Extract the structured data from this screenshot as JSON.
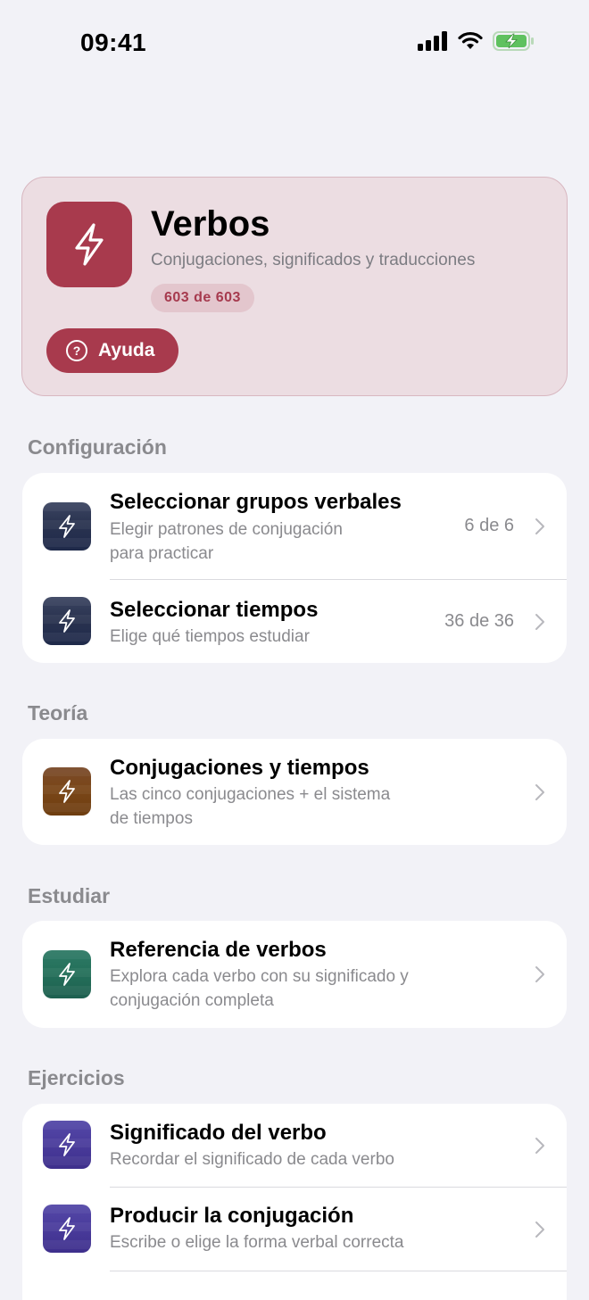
{
  "status_bar": {
    "time": "09:41"
  },
  "hero": {
    "title": "Verbos",
    "subtitle": "Conjugaciones, significados y traducciones",
    "badge": "603 de 603",
    "help_label": "Ayuda",
    "help_glyph": "?",
    "accent_color": "#A83A4D",
    "icon": "lightning-bolt-icon"
  },
  "sections": {
    "configuracion": {
      "header": "Configuración",
      "rows": [
        {
          "title": "Seleccionar grupos verbales",
          "subtitle_line1": "Elegir patrones de conjugación",
          "subtitle_line2": "para practicar",
          "value": "6 de 6",
          "icon_color": "#2A3350"
        },
        {
          "title": "Seleccionar tiempos",
          "subtitle_line1": "Elige qué tiempos estudiar",
          "value": "36 de 36",
          "icon_color": "#2A3350"
        }
      ]
    },
    "teoria": {
      "header": "Teoría",
      "rows": [
        {
          "title": "Conjugaciones y tiempos",
          "subtitle_line1": "Las cinco conjugaciones + el sistema",
          "subtitle_line2": "de tiempos",
          "icon_color": "#7A4618"
        }
      ]
    },
    "estudiar": {
      "header": "Estudiar",
      "rows": [
        {
          "title": "Referencia de verbos",
          "subtitle_line1": "Explora cada verbo con su significado y",
          "subtitle_line2": "conjugación completa",
          "icon_color": "#24705A"
        }
      ]
    },
    "ejercicios": {
      "header": "Ejercicios",
      "rows": [
        {
          "title": "Significado del verbo",
          "subtitle_line1": "Recordar el significado de cada verbo",
          "icon_color": "#4A3C9C"
        },
        {
          "title": "Producir la conjugación",
          "subtitle_line1": "Escribe o elige la forma verbal correcta",
          "icon_color": "#4A3C9C"
        }
      ]
    }
  }
}
